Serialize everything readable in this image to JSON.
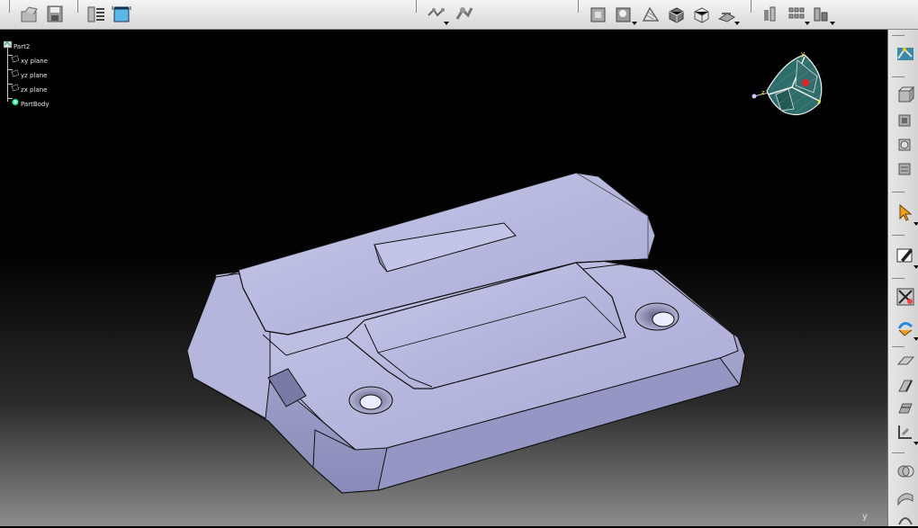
{
  "spec_tree": {
    "root": "Part2",
    "items": [
      {
        "label": "xy plane",
        "icon": "plane-icon"
      },
      {
        "label": "yz plane",
        "icon": "plane-icon"
      },
      {
        "label": "zx plane",
        "icon": "plane-icon"
      },
      {
        "label": "PartBody",
        "icon": "partbody-gear-icon"
      }
    ]
  },
  "compass": {
    "axis_labels": [
      "y",
      "x",
      "z"
    ]
  },
  "viewport": {
    "axis_label": "y"
  },
  "colors": {
    "part_face": "#b0b0d8",
    "part_shadow": "#6e6e98",
    "compass_fill": "#2e6e6a",
    "compass_handle": "#e0222a",
    "toolbar_bg": "#e0e0e0"
  }
}
